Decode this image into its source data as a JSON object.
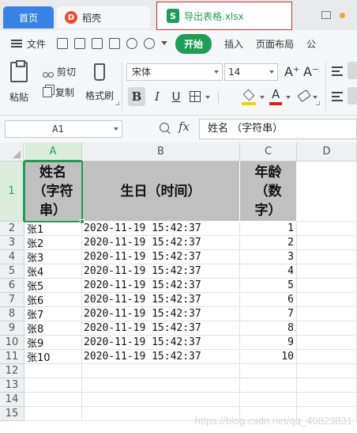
{
  "tabs": {
    "home": "首页",
    "doc": "稻壳",
    "active_file": "导出表格.xlsx"
  },
  "menu": {
    "file": "文件",
    "start": "开始",
    "insert": "插入",
    "layout": "页面布局",
    "formula": "公"
  },
  "ribbon": {
    "paste": "粘贴",
    "cut": "剪切",
    "copy": "复制",
    "format_painter": "格式刷",
    "font_name": "宋体",
    "font_size": "14",
    "bold": "B",
    "italic": "I",
    "underline": "U",
    "font_color_glyph": "A",
    "grow_glyph": "A⁺",
    "shrink_glyph": "A⁻"
  },
  "formula_bar": {
    "cell_ref": "A1",
    "fx": "fx",
    "content": "姓名 （字符串）"
  },
  "sheet": {
    "columns": [
      "A",
      "B",
      "C",
      "D"
    ],
    "row_numbers": [
      "1",
      "2",
      "3",
      "4",
      "5",
      "6",
      "7",
      "8",
      "9",
      "10",
      "11",
      "12",
      "13",
      "14",
      "15"
    ],
    "headers": {
      "a": "姓名（字符串）",
      "b": "生日（时间）",
      "c": "年龄（数字）"
    },
    "rows": [
      {
        "name": "张1",
        "time": "2020-11-19 15:42:37",
        "age": "1"
      },
      {
        "name": "张2",
        "time": "2020-11-19 15:42:37",
        "age": "2"
      },
      {
        "name": "张3",
        "time": "2020-11-19 15:42:37",
        "age": "3"
      },
      {
        "name": "张4",
        "time": "2020-11-19 15:42:37",
        "age": "4"
      },
      {
        "name": "张5",
        "time": "2020-11-19 15:42:37",
        "age": "5"
      },
      {
        "name": "张6",
        "time": "2020-11-19 15:42:37",
        "age": "6"
      },
      {
        "name": "张7",
        "time": "2020-11-19 15:42:37",
        "age": "7"
      },
      {
        "name": "张8",
        "time": "2020-11-19 15:42:37",
        "age": "8"
      },
      {
        "name": "张9",
        "time": "2020-11-19 15:42:37",
        "age": "9"
      },
      {
        "name": "张10",
        "time": "2020-11-19 15:42:37",
        "age": "10"
      }
    ]
  },
  "watermark": "https://blog.csdn.net/qq_40823831"
}
